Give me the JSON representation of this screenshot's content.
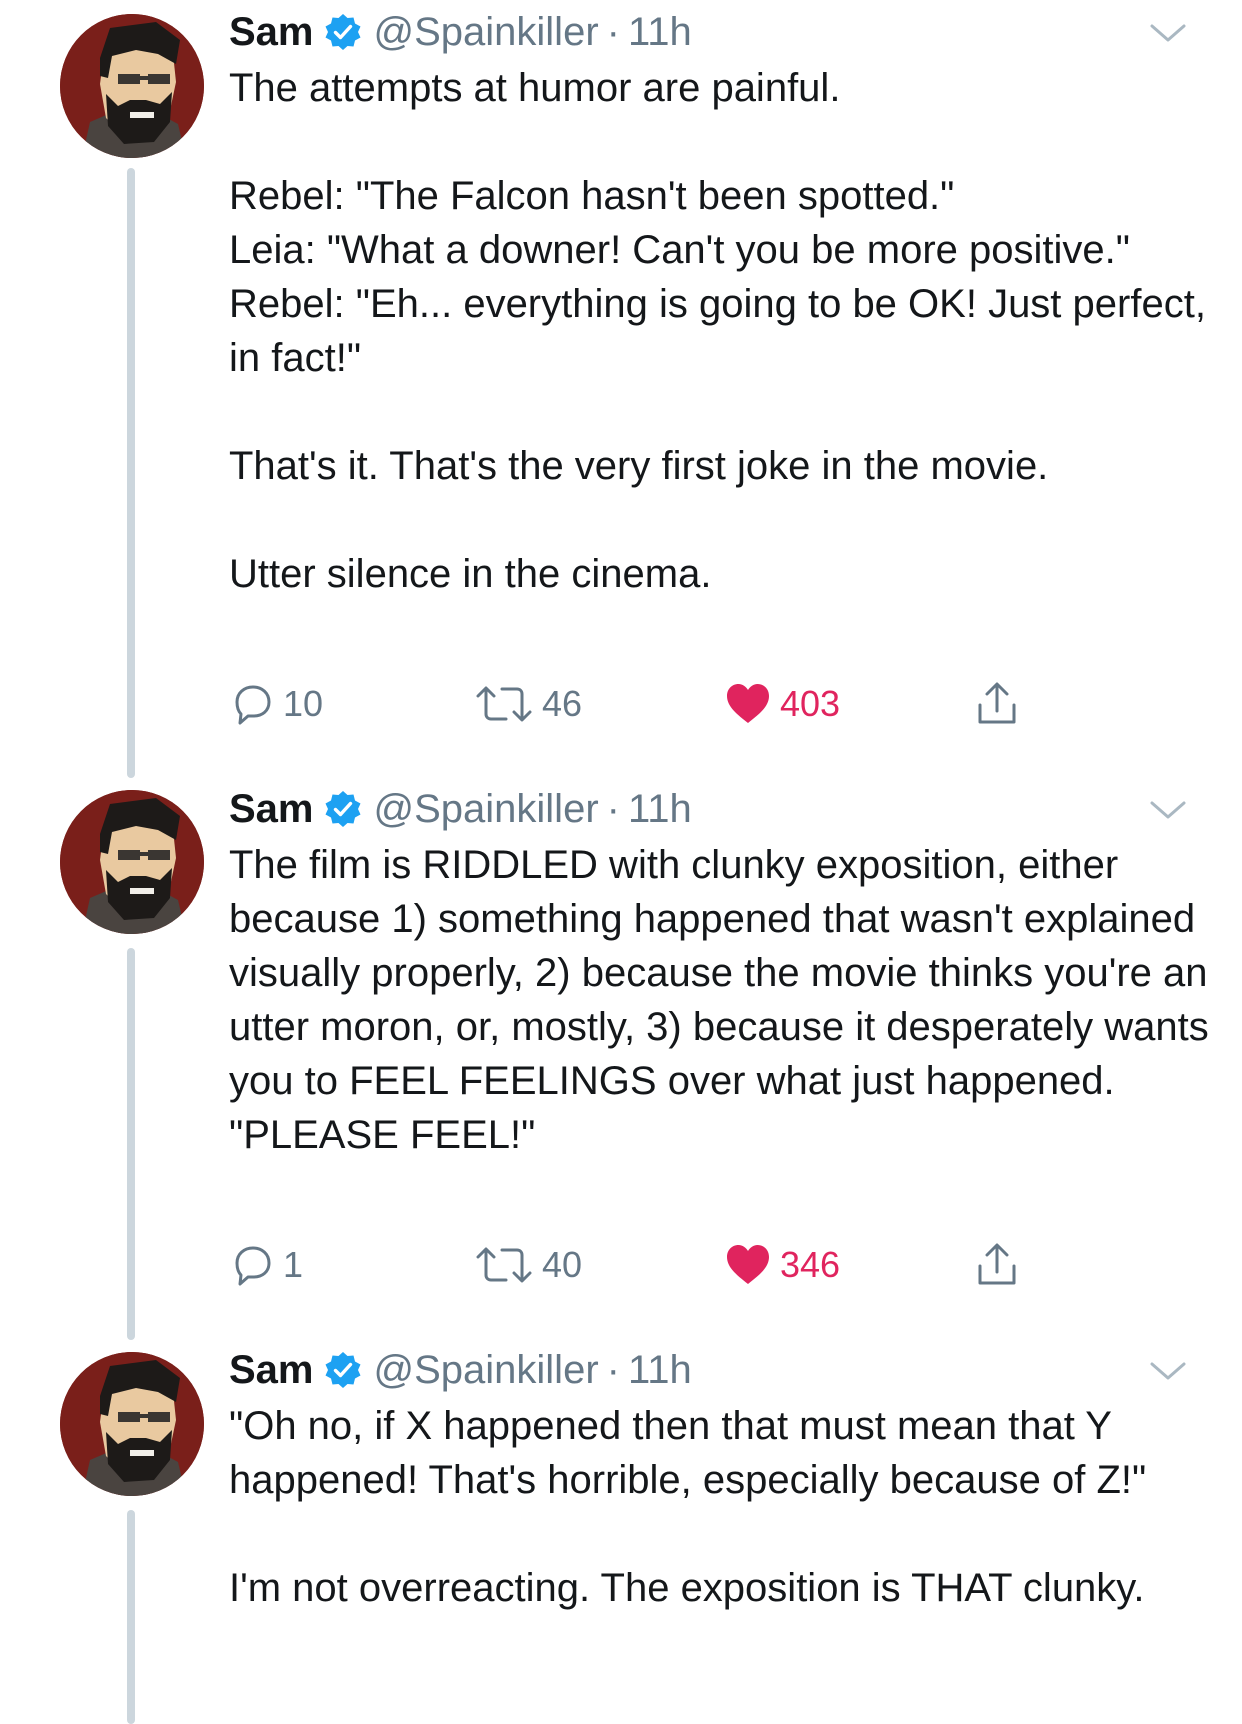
{
  "tweets": [
    {
      "name": "Sam",
      "handle": "@Spainkiller",
      "separator": "·",
      "time": "11h",
      "text": "The attempts at humor are painful.\n\nRebel: \"The Falcon hasn't been spotted.\"\nLeia: \"What a downer! Can't you be more positive.\"\nRebel: \"Eh... everything is going to be OK! Just perfect, in fact!\"\n\nThat's it. That's the very first joke in the movie.\n\nUtter silence in the cinema.",
      "replies": "10",
      "retweets": "46",
      "likes": "403",
      "liked": true
    },
    {
      "name": "Sam",
      "handle": "@Spainkiller",
      "separator": "·",
      "time": "11h",
      "text": "The film is RIDDLED with clunky exposition, either because 1) something happened that wasn't explained visually properly, 2) because the movie thinks you're an utter moron, or, mostly, 3) because it desperately wants you to FEEL FEELINGS over what just happened. \"PLEASE FEEL!\"",
      "replies": "1",
      "retweets": "40",
      "likes": "346",
      "liked": true
    },
    {
      "name": "Sam",
      "handle": "@Spainkiller",
      "separator": "·",
      "time": "11h",
      "text": "\"Oh no, if X happened then that must mean that Y happened! That's horrible, especially because of Z!\"\n\nI'm not overreacting. The exposition is THAT clunky."
    }
  ],
  "icons": {
    "verified": "verified-badge-icon",
    "caret": "chevron-down-icon",
    "reply": "reply-bubble-icon",
    "retweet": "retweet-icon",
    "like": "heart-icon",
    "share": "share-icon"
  },
  "colors": {
    "text": "#14171a",
    "secondary": "#657786",
    "verified": "#1da1f2",
    "like": "#e0245e",
    "thread_line": "#ccd6dd"
  }
}
